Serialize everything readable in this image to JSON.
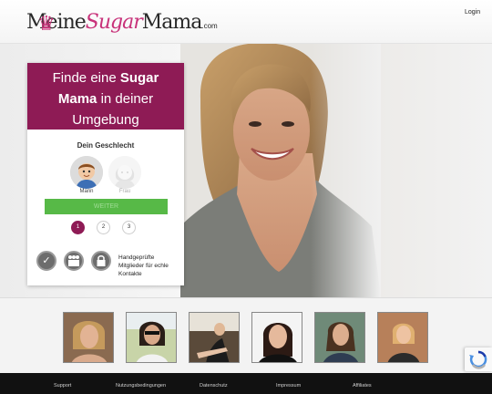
{
  "header": {
    "logo_part1": "Meine",
    "logo_part2": "Sugar",
    "logo_part3": "Mama",
    "logo_part4": ".com",
    "login_label": "Login"
  },
  "signup": {
    "headline_pre": "Finde eine ",
    "headline_bold1": "Sugar",
    "headline_bold2": "Mama",
    "headline_post": " in deiner",
    "headline_line3": "Umgebung",
    "gender_title": "Dein Geschlecht",
    "gender_options": [
      "Mann",
      "Frau"
    ],
    "selected_gender": "Mann",
    "submit_label": "WEITER",
    "steps": [
      "1",
      "2",
      "3"
    ],
    "current_step": "1",
    "trust_text_1": "Handgeprüfte",
    "trust_text_2": "Mitglieder für echle",
    "trust_text_3": "Kontakte",
    "trust_icons": [
      "checkmark-badge-icon",
      "people-badge-icon",
      "lock-badge-icon"
    ]
  },
  "footer": {
    "links": [
      "Support",
      "Nutzungsbedingungen",
      "Datenschutz",
      "Impressum",
      "Affiliates"
    ]
  },
  "colors": {
    "brand": "#8e1b55",
    "button": "#57b947",
    "logo_accent": "#c8327a",
    "footer": "#111111"
  }
}
